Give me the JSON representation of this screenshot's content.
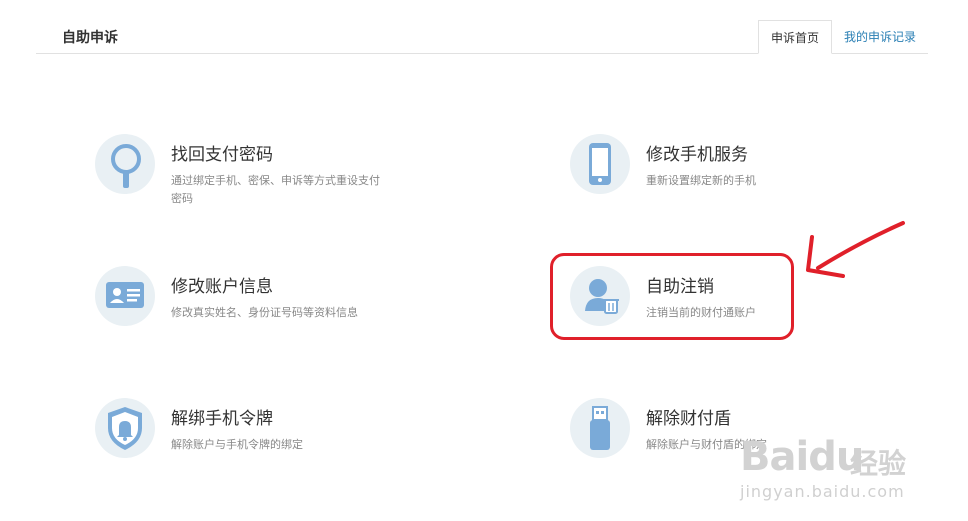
{
  "header": {
    "title": "自助申诉",
    "tabs": [
      {
        "label": "申诉首页",
        "active": true
      },
      {
        "label": "我的申诉记录",
        "active": false
      }
    ]
  },
  "cards": [
    {
      "icon": "magnifier-icon",
      "title": "找回支付密码",
      "desc": "通过绑定手机、密保、申诉等方式重设支付密码"
    },
    {
      "icon": "mobile-phone-icon",
      "title": "修改手机服务",
      "desc": "重新设置绑定新的手机"
    },
    {
      "icon": "id-card-icon",
      "title": "修改账户信息",
      "desc": "修改真实姓名、身份证号码等资料信息"
    },
    {
      "icon": "user-delete-icon",
      "title": "自助注销",
      "desc": "注销当前的财付通账户"
    },
    {
      "icon": "shield-bell-icon",
      "title": "解绑手机令牌",
      "desc": "解除账户与手机令牌的绑定"
    },
    {
      "icon": "usb-key-icon",
      "title": "解除财付盾",
      "desc": "解除账户与财付盾的绑定"
    }
  ],
  "annotation": {
    "color": "#e0202a",
    "target": "自助注销"
  },
  "watermark": {
    "logo": "Baidu",
    "text": "经验",
    "url": "jingyan.baidu.com"
  },
  "colors": {
    "icon_blue": "#7aaad8",
    "icon_bg": "#e9f0f4",
    "link": "#2a7fb4"
  }
}
